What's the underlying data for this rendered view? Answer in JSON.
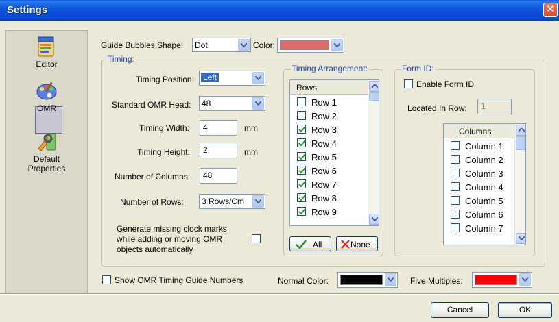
{
  "window": {
    "title": "Settings",
    "close_glyph": "✕"
  },
  "nav": [
    {
      "label_lines": [
        "Editor"
      ],
      "icon": "editor-icon"
    },
    {
      "label_lines": [
        "OMR"
      ],
      "icon": "palette-icon"
    },
    {
      "label_lines": [
        "Default",
        "Properties"
      ],
      "icon": "properties-icon"
    }
  ],
  "guide": {
    "shape_label": "Guide Bubbles Shape:",
    "shape_value": "Dot",
    "color_label": "Color:",
    "color_value": "#dc6b6b"
  },
  "timing": {
    "group_title": "Timing:",
    "position_label": "Timing Position:",
    "position_value": "Left",
    "head_label": "Standard OMR Head:",
    "head_value": "48",
    "width_label": "Timing Width:",
    "width_value": "4",
    "width_unit": "mm",
    "height_label": "Timing Height:",
    "height_value": "2",
    "height_unit": "mm",
    "columns_label": "Number of Columns:",
    "columns_value": "48",
    "rows_label": "Number of Rows:",
    "rows_value": "3 Rows/Cm",
    "generate_line1": "Generate missing clock marks",
    "generate_line2": "while adding or moving OMR",
    "generate_line3": "objects automatically",
    "generate_checked": false
  },
  "arrangement": {
    "group_title": "Timing Arrangement:",
    "header": "Rows",
    "rows": [
      {
        "label": "Row 1",
        "checked": false
      },
      {
        "label": "Row 2",
        "checked": false
      },
      {
        "label": "Row 3",
        "checked": true
      },
      {
        "label": "Row 4",
        "checked": true
      },
      {
        "label": "Row 5",
        "checked": true
      },
      {
        "label": "Row 6",
        "checked": true
      },
      {
        "label": "Row 7",
        "checked": true
      },
      {
        "label": "Row 8",
        "checked": true
      },
      {
        "label": "Row 9",
        "checked": true
      }
    ],
    "all_label": "All",
    "none_label": "None"
  },
  "form_id": {
    "group_title": "Form ID:",
    "enable_label": "Enable Form ID",
    "enable_checked": false,
    "located_label": "Located In Row:",
    "located_value": "1",
    "header": "Columns",
    "columns": [
      {
        "label": "Column 1",
        "checked": false
      },
      {
        "label": "Column 2",
        "checked": false
      },
      {
        "label": "Column 3",
        "checked": false
      },
      {
        "label": "Column 4",
        "checked": false
      },
      {
        "label": "Column 5",
        "checked": false
      },
      {
        "label": "Column 6",
        "checked": false
      },
      {
        "label": "Column 7",
        "checked": false
      }
    ]
  },
  "bottom": {
    "show_numbers_label": "Show OMR Timing Guide Numbers",
    "show_numbers_checked": false,
    "normal_color_label": "Normal Color:",
    "normal_color": "#000000",
    "five_multiples_label": "Five Multiples:",
    "five_multiples_color": "#ff0000"
  },
  "footer": {
    "cancel_label": "Cancel",
    "ok_label": "OK"
  }
}
